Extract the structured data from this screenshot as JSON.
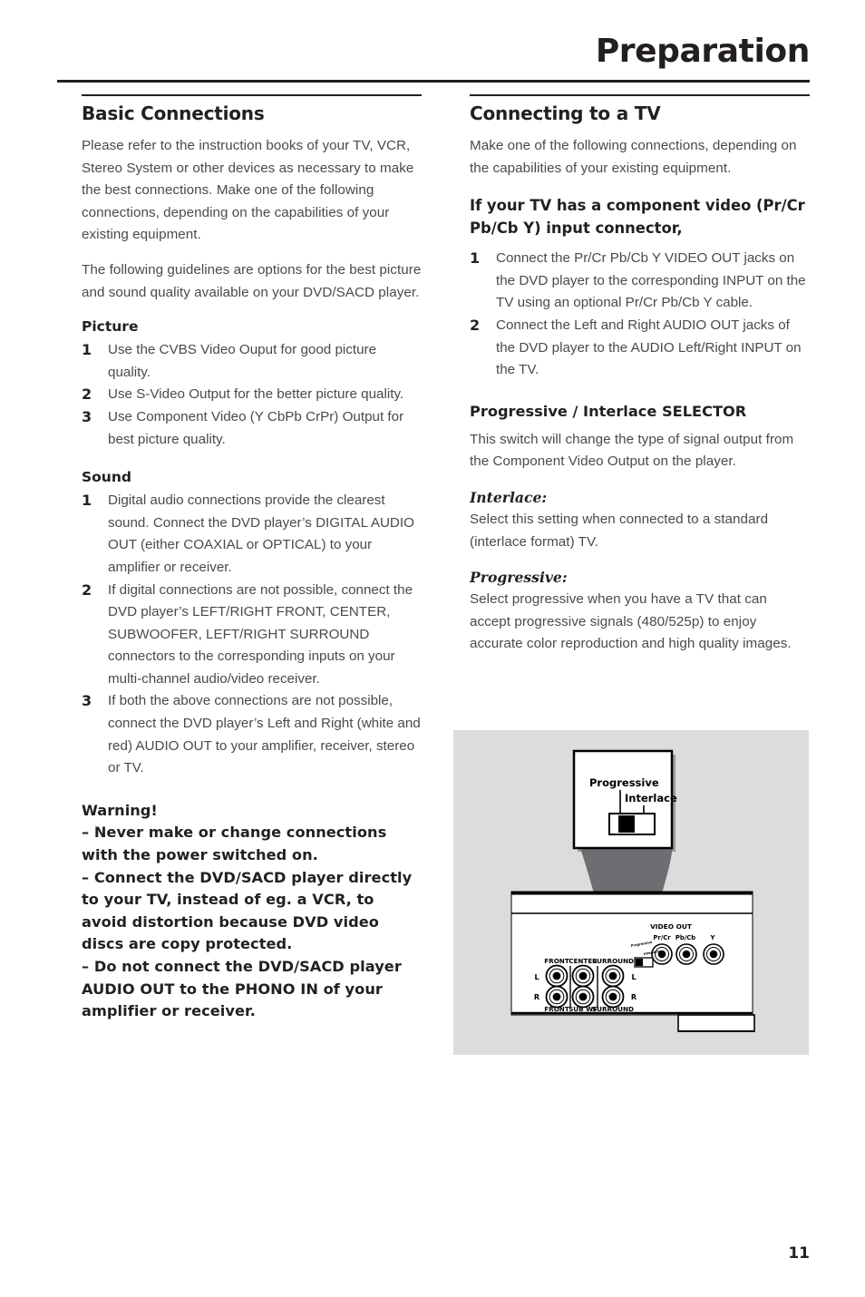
{
  "page": {
    "title": "Preparation",
    "number": "11"
  },
  "left_column": {
    "section_title": "Basic Connections",
    "intro_paragraph_1": "Please refer to the instruction books of your TV, VCR, Stereo System or other devices as necessary to make the best connections. Make one of the following connections, depending on the capabilities of your existing equipment.",
    "intro_paragraph_2": "The following guidelines are options for the best picture and sound quality available on your DVD/SACD player.",
    "picture": {
      "heading": "Picture",
      "items": [
        {
          "num": "1",
          "text": "Use the CVBS Video Ouput for good picture quality."
        },
        {
          "num": "2",
          "text": "Use S-Video Output for the better picture quality."
        },
        {
          "num": "3",
          "text": "Use Component Video (Y CbPb CrPr) Output for best picture quality."
        }
      ]
    },
    "sound": {
      "heading": "Sound",
      "items": [
        {
          "num": "1",
          "text": "Digital audio connections provide the clearest sound. Connect the DVD player’s DIGITAL AUDIO OUT (either COAXIAL or OPTICAL) to your amplifier or receiver."
        },
        {
          "num": "2",
          "text": "If digital connections are not possible, connect the DVD player’s LEFT/RIGHT FRONT, CENTER, SUBWOOFER, LEFT/RIGHT SURROUND connectors to the corresponding inputs on your multi-channel audio/video receiver."
        },
        {
          "num": "3",
          "text": "If both the above connections are not possible, connect the DVD player’s Left and Right (white and red) AUDIO OUT to your amplifier, receiver, stereo or TV."
        }
      ]
    },
    "warning": {
      "heading": "Warning!",
      "line_1": "– Never make or change connections with the power switched on.",
      "line_2": "– Connect the DVD/SACD player directly to your TV, instead of eg. a VCR,  to avoid distortion because DVD video discs are copy protected.",
      "line_3": "– Do not connect the DVD/SACD player AUDIO OUT to the PHONO IN of your amplifier or receiver."
    }
  },
  "right_column": {
    "section_title": "Connecting to a TV",
    "intro_paragraph": "Make one of the following connections, depending on the capabilities of your existing equipment.",
    "component_heading": "If your TV has a component video (Pr/Cr Pb/Cb Y) input connector,",
    "component_items": [
      {
        "num": "1",
        "text": "Connect the Pr/Cr Pb/Cb Y VIDEO OUT jacks on the DVD player to the corresponding INPUT on the TV using an optional Pr/Cr Pb/Cb Y cable."
      },
      {
        "num": "2",
        "text": "Connect the Left and Right AUDIO OUT jacks of the DVD player to the AUDIO Left/Right INPUT on the TV."
      }
    ],
    "selector_heading": "Progressive / Interlace SELECTOR",
    "selector_paragraph": "This switch will change the type of signal output from the Component Video Output on the player.",
    "interlace": {
      "heading": "Interlace:",
      "text": "Select this setting when connected to a standard (interlace format) TV."
    },
    "progressive": {
      "heading": "Progressive:",
      "text": "Select progressive when you have a TV that can accept progressive signals (480/525p) to enjoy accurate color reproduction and high quality images."
    }
  },
  "diagram": {
    "callout": {
      "progressive_label": "Progressive",
      "interlace_label": "Interlace"
    },
    "panel": {
      "video_out_group": "VIDEO OUT",
      "video_jacks": [
        "Pr/Cr",
        "Pb/Cb",
        "Y"
      ],
      "audio_top_labels": [
        "FRONT",
        "CENTER",
        "SURROUND"
      ],
      "audio_bottom_labels": [
        "FRONT",
        "SUB WF",
        "SURROUND"
      ],
      "left_channel_top": "L",
      "right_channel_top": "L",
      "left_channel_bottom": "R",
      "right_channel_bottom": "R",
      "switch_progressive": "Progressive",
      "switch_interlace": "Interlace"
    },
    "colors": {
      "background": "#dcdcdc",
      "panel": "#ffffff",
      "ink": "#000000",
      "arrow": "#6d6e71"
    }
  }
}
